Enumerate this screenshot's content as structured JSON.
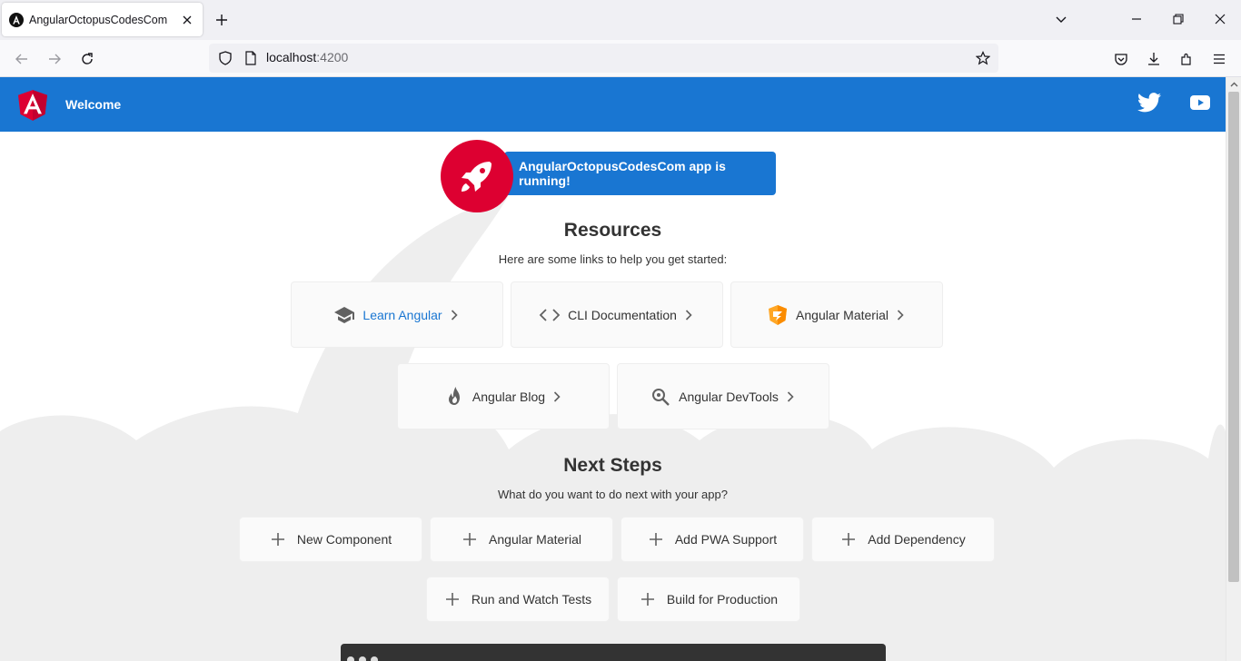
{
  "browser": {
    "tab_title": "AngularOctopusCodesCom",
    "url_host": "localhost",
    "url_port": ":4200"
  },
  "toolbar": {
    "title": "Welcome",
    "brand_color": "#1976d2"
  },
  "hero": {
    "running_text": "AngularOctopusCodesCom app is running!",
    "rocket_color": "#dd0031"
  },
  "resources": {
    "heading": "Resources",
    "subheading": "Here are some links to help you get started:",
    "cards": [
      {
        "label": "Learn Angular",
        "icon": "graduation-cap-icon"
      },
      {
        "label": "CLI Documentation",
        "icon": "code-icon"
      },
      {
        "label": "Angular Material",
        "icon": "angular-material-icon"
      },
      {
        "label": "Angular Blog",
        "icon": "flame-icon"
      },
      {
        "label": "Angular DevTools",
        "icon": "magnifier-icon"
      }
    ]
  },
  "next_steps": {
    "heading": "Next Steps",
    "subheading": "What do you want to do next with your app?",
    "buttons": [
      {
        "label": "New Component"
      },
      {
        "label": "Angular Material"
      },
      {
        "label": "Add PWA Support"
      },
      {
        "label": "Add Dependency"
      },
      {
        "label": "Run and Watch Tests"
      },
      {
        "label": "Build for Production"
      }
    ]
  }
}
